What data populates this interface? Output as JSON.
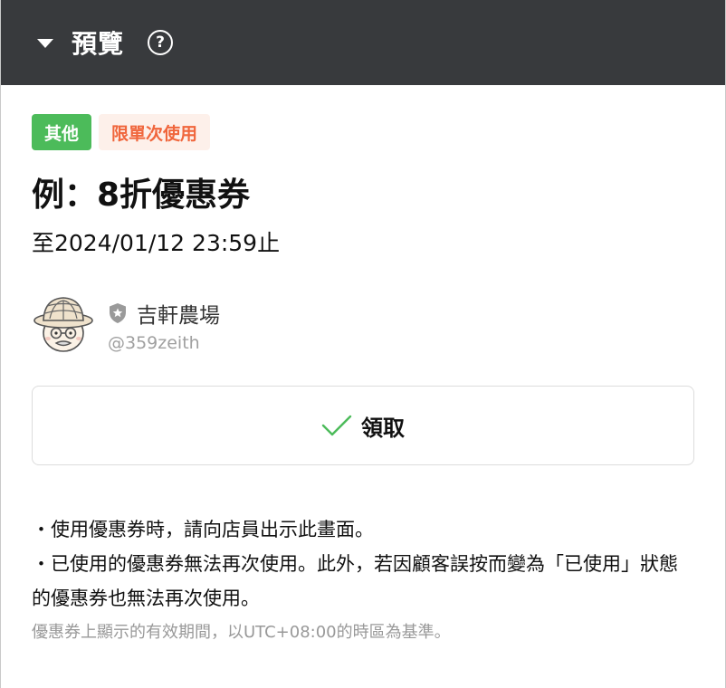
{
  "header": {
    "title": "預覽",
    "help_icon": "?"
  },
  "coupon": {
    "tags": {
      "category": "其他",
      "usage": "限單次使用"
    },
    "title": "例：8折優惠券",
    "expiry": "至2024/01/12 23:59止",
    "account": {
      "name": "吉軒農場",
      "id": "@359zeith"
    },
    "claim_label": "領取",
    "notes": [
      "・使用優惠券時，請向店員出示此畫面。",
      "・已使用的優惠券無法再次使用。此外，若因顧客誤按而變為「已使用」狀態的優惠券也無法再次使用。"
    ],
    "timezone_note": "優惠券上顯示的有效期間，以UTC+08:00的時區為基準。"
  },
  "colors": {
    "header_bg": "#383a3d",
    "tag_category_bg": "#4cbb5a",
    "tag_usage_bg": "#fdf0ea",
    "tag_usage_text": "#f0663c",
    "check": "#4cbb5a"
  }
}
